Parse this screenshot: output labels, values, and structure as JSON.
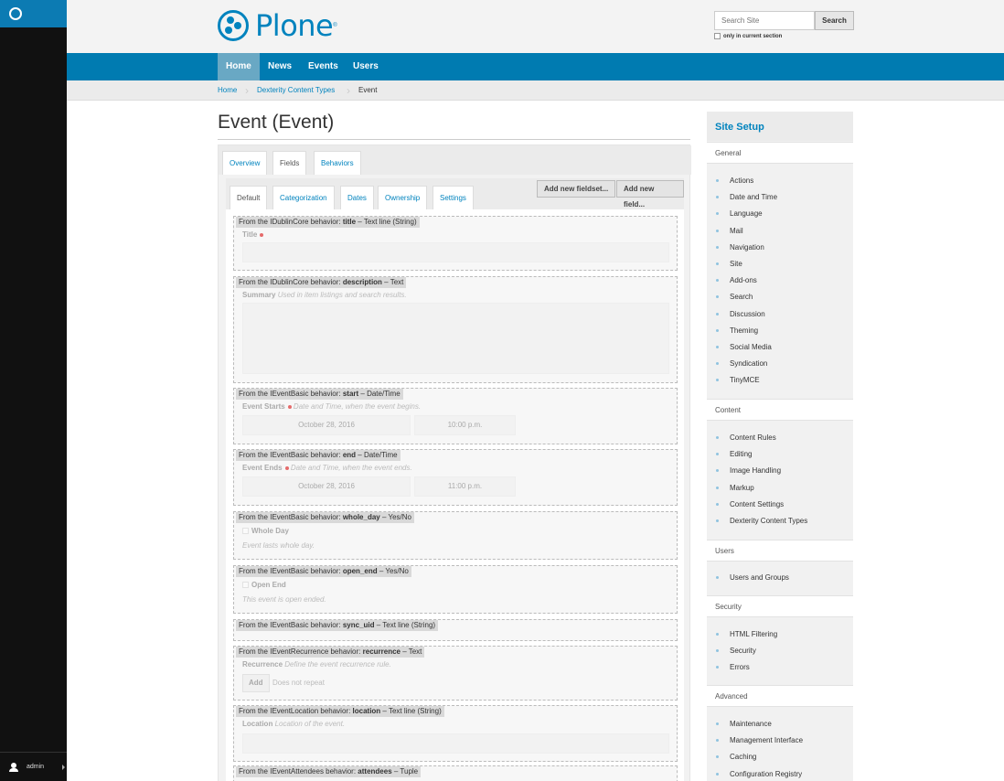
{
  "toolbar": {
    "user": "admin"
  },
  "header": {
    "logo_text": "Plone",
    "logo_mark": "®",
    "search_placeholder": "Search Site",
    "search_button": "Search",
    "search_option": "only in current section"
  },
  "nav": [
    "Home",
    "News",
    "Events",
    "Users"
  ],
  "breadcrumbs": [
    "Home",
    "Dexterity Content Types",
    "Event"
  ],
  "page_title": "Event (Event)",
  "tabs": [
    "Overview",
    "Fields",
    "Behaviors"
  ],
  "subtabs": [
    "Default",
    "Categorization",
    "Dates",
    "Ownership",
    "Settings"
  ],
  "buttons": {
    "add_fieldset": "Add new fieldset...",
    "add_field": "Add new field..."
  },
  "fields": {
    "title": {
      "prefix": "From the IDublinCore behavior: ",
      "name": "title",
      "suffix": " – Text line (String)",
      "label": "Title"
    },
    "description": {
      "prefix": "From the IDublinCore behavior: ",
      "name": "description",
      "suffix": " – Text",
      "label": "Summary",
      "help": "Used in item listings and search results."
    },
    "start": {
      "prefix": "From the IEventBasic behavior: ",
      "name": "start",
      "suffix": " – Date/Time",
      "label": "Event Starts",
      "help": "Date and Time, when the event begins.",
      "date": "October 28, 2016",
      "time": "10:00 p.m."
    },
    "end": {
      "prefix": "From the IEventBasic behavior: ",
      "name": "end",
      "suffix": " – Date/Time",
      "label": "Event Ends",
      "help": "Date and Time, when the event ends.",
      "date": "October 28, 2016",
      "time": "11:00 p.m."
    },
    "whole_day": {
      "prefix": "From the IEventBasic behavior: ",
      "name": "whole_day",
      "suffix": " – Yes/No",
      "label": "Whole Day",
      "help": "Event lasts whole day."
    },
    "open_end": {
      "prefix": "From the IEventBasic behavior: ",
      "name": "open_end",
      "suffix": " – Yes/No",
      "label": "Open End",
      "help": "This event is open ended."
    },
    "sync_uid": {
      "prefix": "From the IEventBasic behavior: ",
      "name": "sync_uid",
      "suffix": " – Text line (String)"
    },
    "recurrence": {
      "prefix": "From the IEventRecurrence behavior: ",
      "name": "recurrence",
      "suffix": " – Text",
      "label": "Recurrence",
      "help": "Define the event recurrence rule.",
      "add": "Add",
      "state": "Does not repeat"
    },
    "location": {
      "prefix": "From the IEventLocation behavior: ",
      "name": "location",
      "suffix": " – Text line (String)",
      "label": "Location",
      "help": "Location of the event."
    },
    "attendees": {
      "prefix": "From the IEventAttendees behavior: ",
      "name": "attendees",
      "suffix": " – Tuple"
    }
  },
  "portlet": {
    "title": "Site Setup",
    "general": {
      "label": "General",
      "items": [
        "Actions",
        "Date and Time",
        "Language",
        "Mail",
        "Navigation",
        "Site",
        "Add-ons",
        "Search",
        "Discussion",
        "Theming",
        "Social Media",
        "Syndication",
        "TinyMCE"
      ]
    },
    "content": {
      "label": "Content",
      "items": [
        "Content Rules",
        "Editing",
        "Image Handling",
        "Markup",
        "Content Settings",
        "Dexterity Content Types"
      ]
    },
    "users": {
      "label": "Users",
      "items": [
        "Users and Groups"
      ]
    },
    "security": {
      "label": "Security",
      "items": [
        "HTML Filtering",
        "Security",
        "Errors"
      ]
    },
    "advanced": {
      "label": "Advanced",
      "items": [
        "Maintenance",
        "Management Interface",
        "Caching",
        "Configuration Registry"
      ]
    }
  },
  "colors": {
    "brand": "#0083be",
    "nav": "#007bb1",
    "toolbar": "#111111"
  }
}
